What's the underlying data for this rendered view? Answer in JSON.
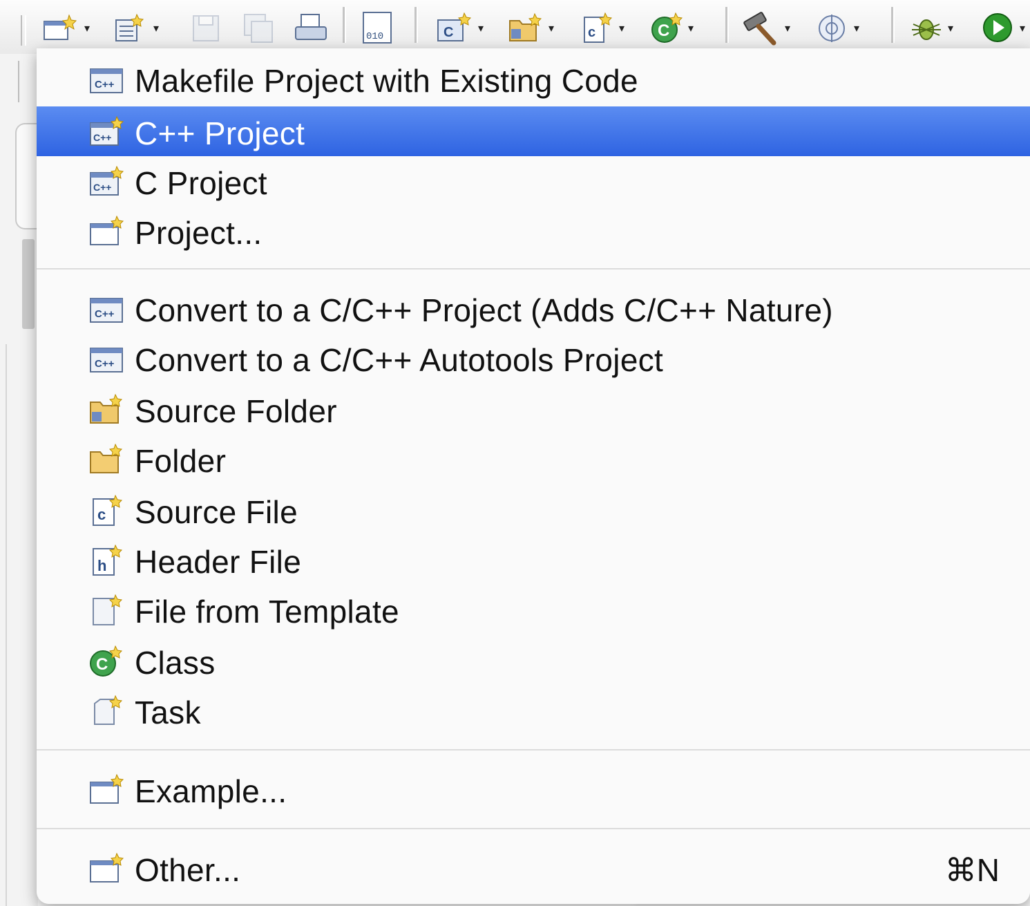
{
  "toolbar": {
    "buttons": [
      {
        "icon": "new-wizard-icon",
        "has_dropdown": true
      },
      {
        "icon": "new-file-icon",
        "has_dropdown": true
      },
      {
        "icon": "save-icon",
        "disabled": true
      },
      {
        "icon": "save-all-icon",
        "disabled": true
      },
      {
        "icon": "print-icon"
      },
      {
        "icon": "binary-file-icon"
      },
      {
        "icon": "new-cpp-project-icon",
        "has_dropdown": true
      },
      {
        "icon": "new-source-folder-icon",
        "has_dropdown": true
      },
      {
        "icon": "new-source-file-icon",
        "has_dropdown": true
      },
      {
        "icon": "new-class-icon",
        "has_dropdown": true
      },
      {
        "icon": "build-hammer-icon",
        "has_dropdown": true
      },
      {
        "icon": "target-icon",
        "has_dropdown": true
      },
      {
        "icon": "debug-bug-icon",
        "has_dropdown": true
      },
      {
        "icon": "run-icon",
        "has_dropdown": true
      }
    ]
  },
  "menu": {
    "items": [
      {
        "label": "Makefile Project with Existing Code",
        "icon": "cpp-project-icon"
      },
      {
        "label": "C++ Project",
        "icon": "new-cpp-project-icon",
        "selected": true
      },
      {
        "label": "C Project",
        "icon": "new-c-project-icon"
      },
      {
        "label": "Project...",
        "icon": "new-project-icon"
      },
      {
        "label": "Convert to a C/C++ Project (Adds C/C++ Nature)",
        "icon": "cpp-project-icon"
      },
      {
        "label": "Convert to a C/C++ Autotools Project",
        "icon": "cpp-project-icon"
      },
      {
        "label": "Source Folder",
        "icon": "source-folder-icon"
      },
      {
        "label": "Folder",
        "icon": "folder-icon"
      },
      {
        "label": "Source File",
        "icon": "c-source-file-icon"
      },
      {
        "label": "Header File",
        "icon": "header-file-icon"
      },
      {
        "label": "File from Template",
        "icon": "template-file-icon"
      },
      {
        "label": "Class",
        "icon": "class-icon"
      },
      {
        "label": "Task",
        "icon": "task-icon"
      },
      {
        "label": "Example...",
        "icon": "new-project-icon"
      },
      {
        "label": "Other...",
        "icon": "new-project-icon",
        "shortcut": "⌘N"
      }
    ]
  },
  "colors": {
    "selection": "#3a6fe6",
    "menu_background": "#fafafa",
    "text": "#111111"
  }
}
